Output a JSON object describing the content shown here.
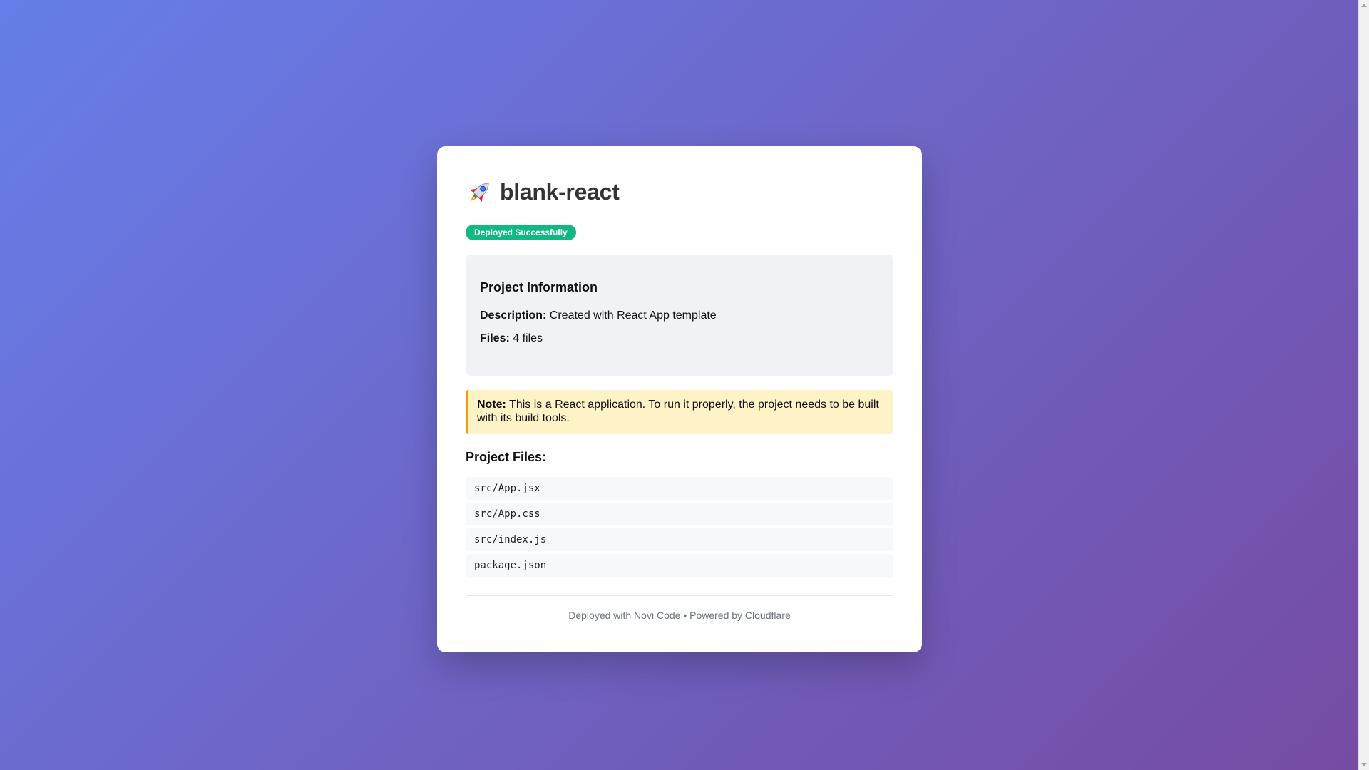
{
  "project": {
    "title": "blank-react",
    "icon": "rocket-icon",
    "status_badge": "Deployed Successfully"
  },
  "info": {
    "heading": "Project Information",
    "description_label": "Description:",
    "description_value": "Created with React App template",
    "files_label": "Files:",
    "files_value": "4 files"
  },
  "note": {
    "label": "Note:",
    "text": "This is a React application. To run it properly, the project needs to be built with its build tools."
  },
  "files": {
    "heading": "Project Files:",
    "items": [
      "src/App.jsx",
      "src/App.css",
      "src/index.js",
      "package.json"
    ]
  },
  "footer": {
    "text": "Deployed with Novi Code • Powered by Cloudflare"
  },
  "colors": {
    "bg_gradient_start": "#667eea",
    "bg_gradient_end": "#764ba2",
    "badge_green": "#10b981",
    "note_bg": "#fef3c7",
    "note_border": "#f59e0b"
  }
}
